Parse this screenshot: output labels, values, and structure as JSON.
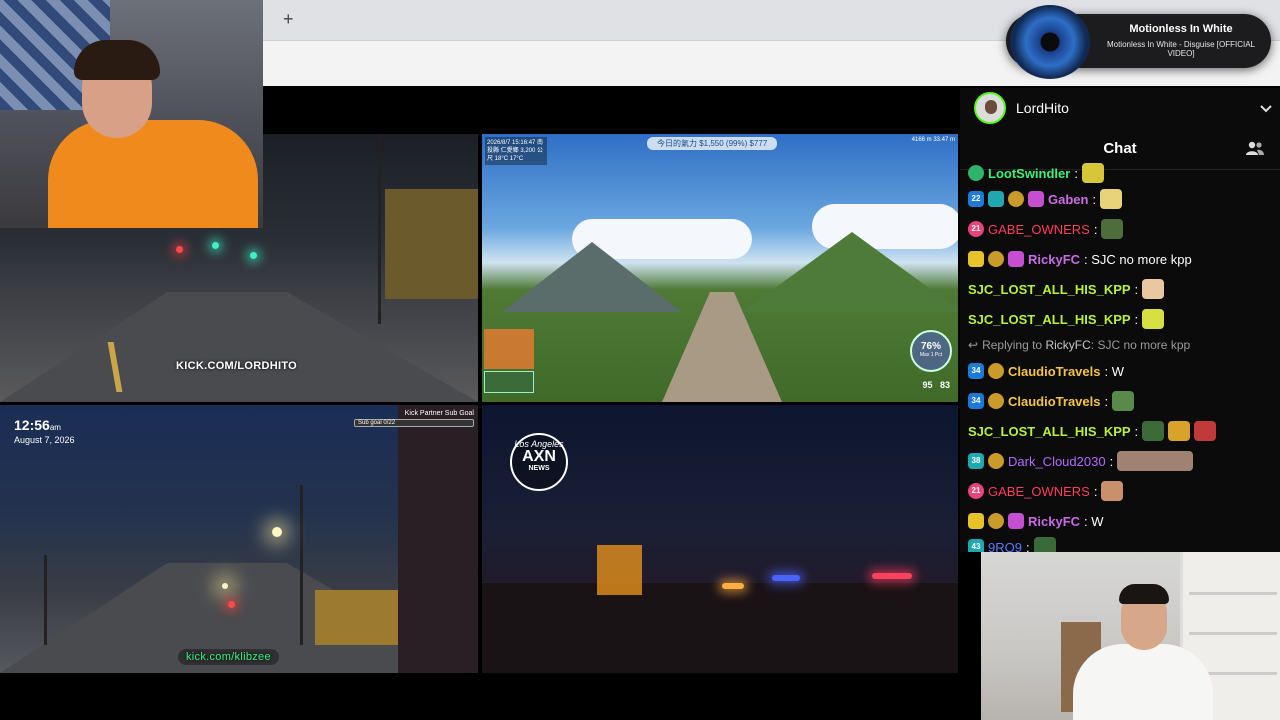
{
  "browser": {
    "new_tab_symbol": "+"
  },
  "toast": {
    "artist": "Motionless In White",
    "track": "Motionless In White - Disguise [OFFICIAL VIDEO]"
  },
  "chat": {
    "channel_name": "LordHito",
    "title": "Chat",
    "messages": [
      {
        "user": "LootSwindler",
        "text": "",
        "user_color": "#3df07a"
      },
      {
        "user": "Gaben",
        "text": "",
        "user_color": "#d06be6",
        "badge": "22"
      },
      {
        "user": "GABE_OWNERS",
        "text": "",
        "user_color": "#ff3d5f",
        "badge": "21"
      },
      {
        "user": "RickyFC",
        "text": "SJC no more kpp",
        "user_color": "#c86be6"
      },
      {
        "user": "SJC_LOST_ALL_HIS_KPP",
        "text": "",
        "user_color": "#b7f238"
      },
      {
        "user": "SJC_LOST_ALL_HIS_KPP",
        "text": "",
        "user_color": "#b7f238"
      },
      {
        "reply_prefix": "Replying to",
        "reply_user": "RickyFC",
        "reply_text": "SJC no more kpp"
      },
      {
        "user": "ClaudioTravels",
        "text": "W",
        "user_color": "#f4c542",
        "badge": "34"
      },
      {
        "user": "ClaudioTravels",
        "text": "",
        "user_color": "#f4c542",
        "badge": "34"
      },
      {
        "user": "SJC_LOST_ALL_HIS_KPP",
        "text": "",
        "user_color": "#b7f238"
      },
      {
        "user": "Dark_Cloud2030",
        "text": "",
        "user_color": "#b36bff",
        "badge": "38"
      },
      {
        "user": "GABE_OWNERS",
        "text": "",
        "user_color": "#ff3d5f",
        "badge": "21"
      },
      {
        "user": "RickyFC",
        "text": "W",
        "user_color": "#c86be6"
      },
      {
        "user": "9RO9",
        "text": "",
        "user_color": "#5a78ff",
        "badge": "43"
      }
    ]
  },
  "tiles": {
    "night_street": {
      "watermark": "KICK.COM/LORDHITO"
    },
    "mountain": {
      "hud_top": "今日的氣力  $1,550 (99%)  $777",
      "hud_left": "2026/8/7 15:16:47 南投縣 仁愛鄉 3,200 公尺 18°C 17°C",
      "hud_right": "4166 m 33.47 m",
      "gauge_value": "76%",
      "gauge_label": "Max 1 Pct",
      "stat_left": "95",
      "stat_right": "83"
    },
    "dashcam": {
      "time": "12:56",
      "ampm": "am",
      "date": "August 7, 2026",
      "sub_goal_title": "Kick Partner Sub Goal",
      "sub_goal_bar": "Sub goal 0/22",
      "watermark": "kick.com/klibzee"
    },
    "news": {
      "logo_top": "Los Angeles",
      "logo_main": "AXN",
      "logo_bottom": "NEWS"
    }
  },
  "colors": {
    "kick_green": "#53fc18",
    "chat_bg": "#0b0b0c"
  }
}
